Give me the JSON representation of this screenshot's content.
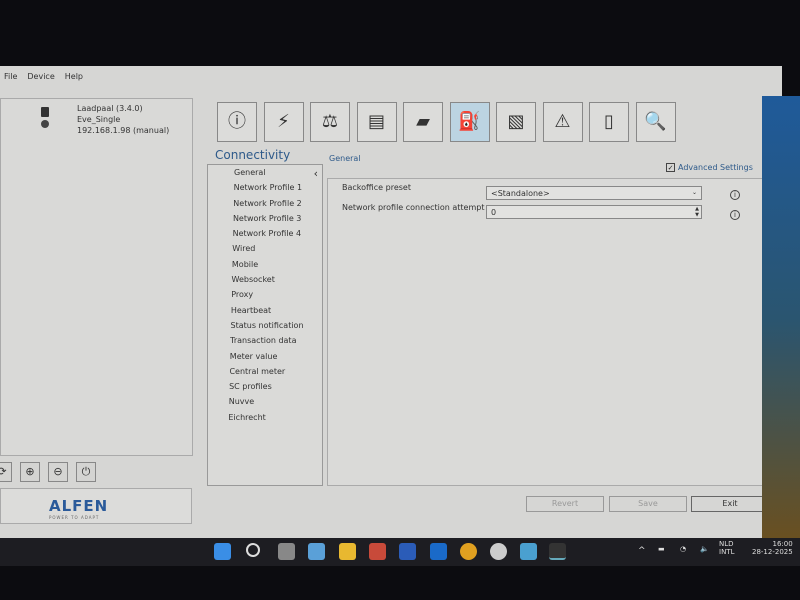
{
  "menu": [
    "File",
    "Device",
    "Help"
  ],
  "device": {
    "name": "Laadpaal (3.4.0)",
    "model": "Eve_Single",
    "address": "192.168.1.98 (manual)"
  },
  "toolbar": [
    {
      "icon": "info-icon",
      "glyph": "ⓘ"
    },
    {
      "icon": "power-pylon-icon",
      "glyph": "⚡"
    },
    {
      "icon": "balance-icon",
      "glyph": "⚖"
    },
    {
      "icon": "card-icon",
      "glyph": "▤"
    },
    {
      "icon": "card-reader-icon",
      "glyph": "▰"
    },
    {
      "icon": "charging-station-icon",
      "glyph": "⛽",
      "active": true
    },
    {
      "icon": "image-icon",
      "glyph": "▧"
    },
    {
      "icon": "warning-icon",
      "glyph": "⚠"
    },
    {
      "icon": "document-icon",
      "glyph": "▯"
    },
    {
      "icon": "monitor-search-icon",
      "glyph": "🔍"
    }
  ],
  "section_title": "Connectivity",
  "sub_title": "General",
  "nav": [
    "General",
    "Network Profile 1",
    "Network Profile 2",
    "Network Profile 3",
    "Network Profile 4",
    "Wired",
    "Mobile",
    "Websocket",
    "Proxy",
    "Heartbeat",
    "Status notification",
    "Transaction data",
    "Meter value",
    "Central meter",
    "SC profiles",
    "Nuvve",
    "Eichrecht"
  ],
  "advanced_settings": {
    "label": "Advanced Settings",
    "checked": true
  },
  "fields": [
    {
      "label": "Backoffice preset",
      "value": "<Standalone>"
    },
    {
      "label": "Network profile connection attempt",
      "value": "0"
    }
  ],
  "buttons": {
    "revert": "Revert",
    "save": "Save",
    "exit": "Exit"
  },
  "logo": {
    "name": "ALFEN",
    "tagline": "POWER TO ADAPT"
  },
  "tray": {
    "lang1": "NLD",
    "lang2": "INTL",
    "time": "16:00",
    "date": "28-12-2025"
  },
  "accent": "#2e5a8a"
}
